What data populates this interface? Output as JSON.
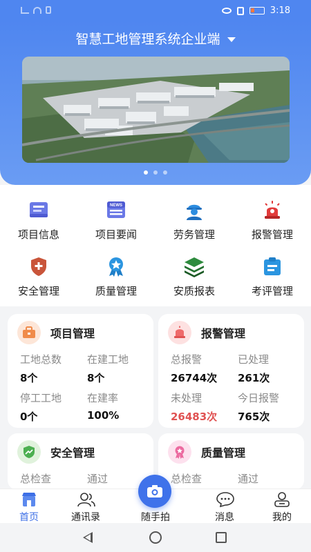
{
  "status": {
    "time": "3:18"
  },
  "header": {
    "title": "智慧工地管理系统企业端"
  },
  "menu": [
    {
      "label": "项目信息",
      "icon": "project-info-icon"
    },
    {
      "label": "项目要闻",
      "icon": "news-icon"
    },
    {
      "label": "劳务管理",
      "icon": "worker-icon"
    },
    {
      "label": "报警管理",
      "icon": "alarm-icon"
    },
    {
      "label": "安全管理",
      "icon": "safety-shield-icon"
    },
    {
      "label": "质量管理",
      "icon": "quality-medal-icon"
    },
    {
      "label": "安质报表",
      "icon": "layers-icon"
    },
    {
      "label": "考评管理",
      "icon": "evaluation-icon"
    }
  ],
  "cards": {
    "project": {
      "title": "项目管理",
      "stats": [
        {
          "label": "工地总数",
          "value": "8个"
        },
        {
          "label": "在建工地",
          "value": "8个"
        },
        {
          "label": "停工工地",
          "value": "0个"
        },
        {
          "label": "在建率",
          "value": "100%"
        }
      ]
    },
    "alarm": {
      "title": "报警管理",
      "stats": [
        {
          "label": "总报警",
          "value": "26744次"
        },
        {
          "label": "已处理",
          "value": "261次"
        },
        {
          "label": "未处理",
          "value": "26483次"
        },
        {
          "label": "今日报警",
          "value": "765次"
        }
      ]
    },
    "safety": {
      "title": "安全管理",
      "stats": [
        {
          "label": "总检查"
        },
        {
          "label": "通过"
        }
      ]
    },
    "quality": {
      "title": "质量管理",
      "stats": [
        {
          "label": "总检查"
        },
        {
          "label": "通过"
        }
      ]
    }
  },
  "tabs": [
    {
      "label": "首页"
    },
    {
      "label": "通讯录"
    },
    {
      "label": "随手拍"
    },
    {
      "label": "消息"
    },
    {
      "label": "我的"
    }
  ],
  "colors": {
    "primary": "#4f86f0",
    "alarm": "#e05252"
  }
}
